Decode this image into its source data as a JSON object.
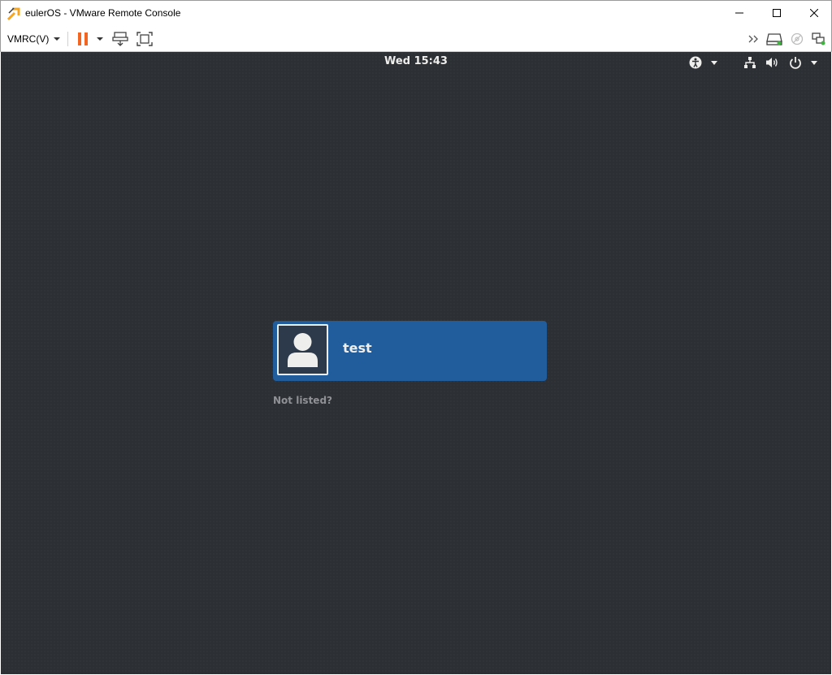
{
  "window": {
    "title": "eulerOS - VMware Remote Console",
    "controls": [
      "minimize",
      "maximize",
      "close"
    ]
  },
  "toolbar": {
    "vmrc_menu_label": "VMRC(V)",
    "icons": [
      "pause-icon",
      "send-ctrl-alt-del-icon",
      "fullscreen-icon",
      "more-icon",
      "removable-devices-icon",
      "cd-icon",
      "network-adapter-icon"
    ],
    "accent_color": "#f26522"
  },
  "guest": {
    "clock": "Wed 15:43",
    "top_icons": [
      "accessibility-icon",
      "network-icon",
      "volume-icon",
      "power-icon"
    ],
    "user_name": "test",
    "not_listed_label": "Not listed?",
    "colors": {
      "background": "#2c2f33",
      "user_card": "#215d9c"
    }
  }
}
